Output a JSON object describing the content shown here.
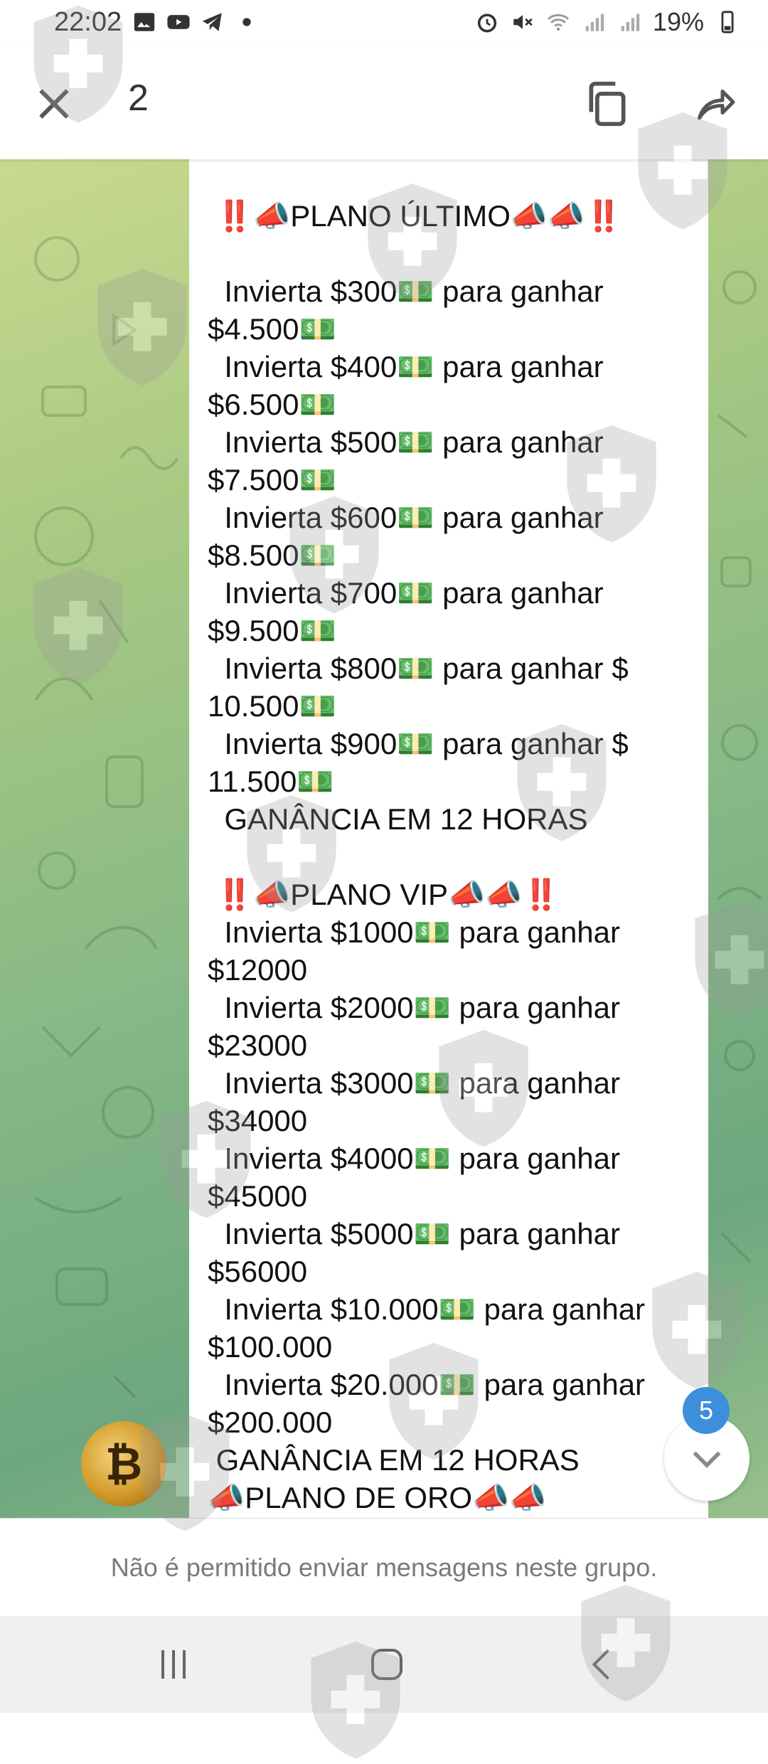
{
  "status_bar": {
    "time": "22:02",
    "battery": "19%",
    "icons": [
      "image-icon",
      "youtube-icon",
      "telegram-icon",
      "dot-icon",
      "alarm-icon",
      "mute-icon",
      "wifi-icon",
      "signal-icon",
      "signal-icon",
      "battery-icon"
    ]
  },
  "app_bar": {
    "counter": "2",
    "close_icon": "close-icon",
    "copy_icon": "copy-icon",
    "share_icon": "share-icon"
  },
  "message": {
    "lines": [
      "",
      " ‼️📣PLANO ÚLTIMO📣📣‼️",
      "",
      "  Invierta $300💵 para ganhar",
      "$4.500💵",
      "  Invierta $400💵 para ganhar",
      "$6.500💵",
      "  Invierta $500💵 para ganhar",
      "$7.500💵",
      "  Invierta $600💵 para ganhar",
      "$8.500💵",
      "  Invierta $700💵 para ganhar",
      "$9.500💵",
      "  Invierta $800💵 para ganhar $",
      "10.500💵",
      "  Invierta $900💵 para ganhar $",
      "11.500💵",
      "  GANÂNCIA EM 12 HORAS",
      "",
      " ‼️📣PLANO VIP📣📣‼️",
      "  Invierta $1000💵 para ganhar",
      "$12000",
      "  Invierta $2000💵 para ganhar",
      "$23000",
      "  Invierta $3000💵 para ganhar",
      "$34000",
      "  Invierta $4000💵 para ganhar",
      "$45000",
      "  Invierta $5000💵 para ganhar",
      "$56000",
      "  Invierta $10.000💵 para ganhar",
      "$100.000",
      "  Invierta $20.000💵 para ganhar",
      "$200.000",
      " GANÂNCIA EM 12 HORAS",
      "📣PLANO DE ORO📣📣"
    ]
  },
  "avatar_symbol": "₿",
  "unread_badge": "5",
  "restricted_notice": "Não é permitido enviar mensagens neste grupo.",
  "nav": {
    "recent_icon": "recent-apps-icon",
    "home_icon": "home-icon",
    "back_icon": "back-icon"
  },
  "colors": {
    "badge": "#3e8fdb",
    "chat_bg_light": "#c9d98e",
    "chat_bg_dark": "#6ea77f",
    "nav_bg": "#f0f0f0"
  }
}
